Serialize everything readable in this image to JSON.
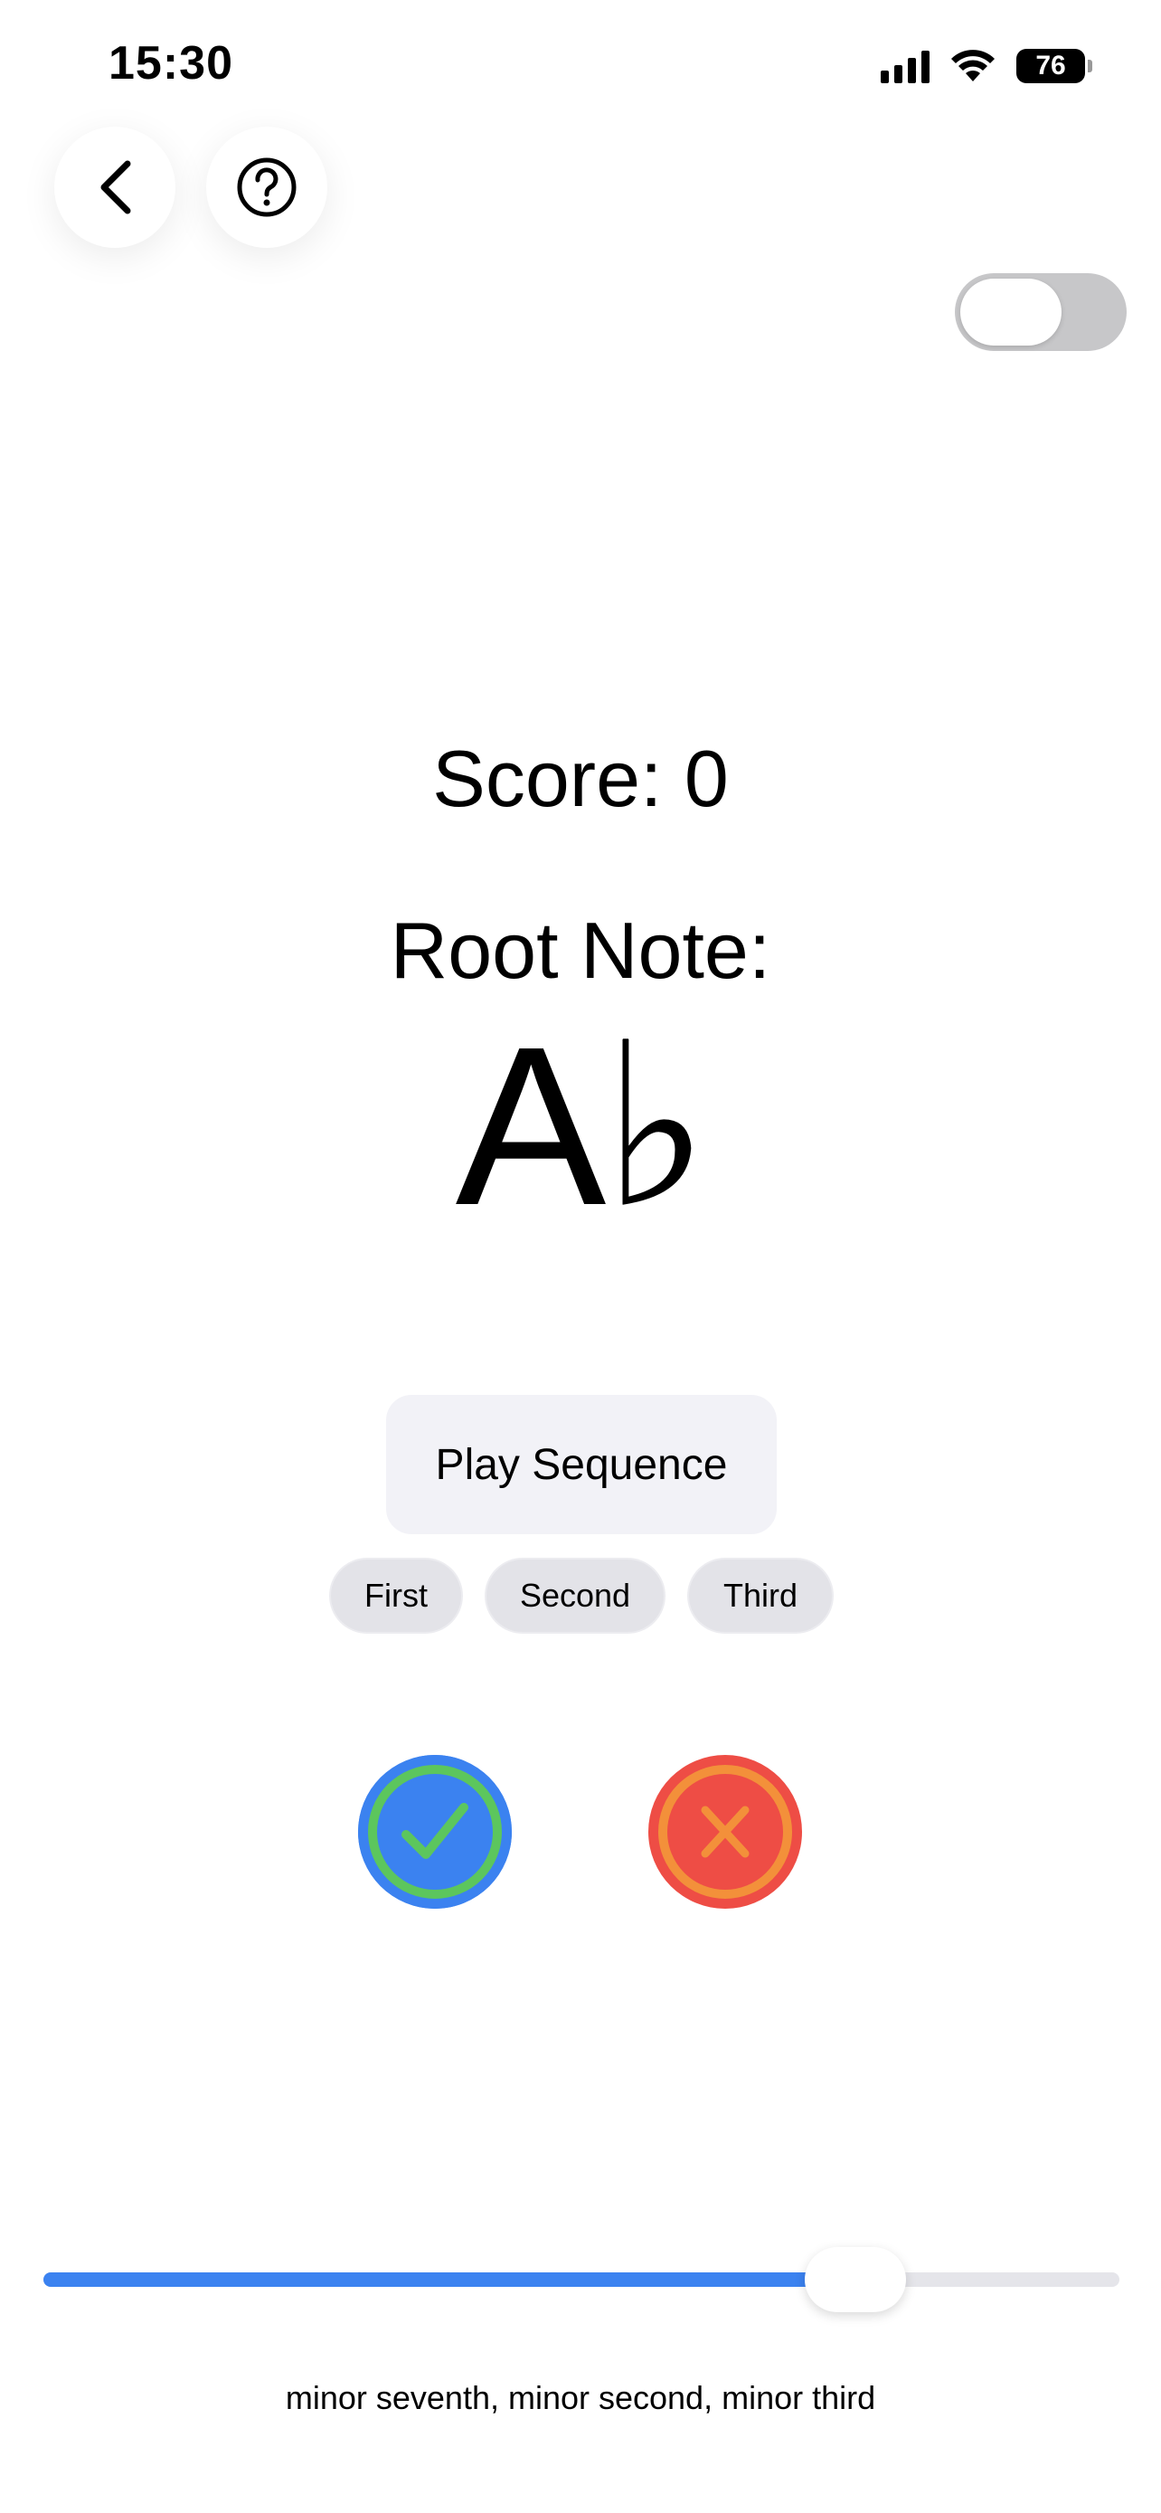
{
  "status_bar": {
    "time": "15:30",
    "battery_level": "76",
    "icons": [
      "signal-icon",
      "wifi-icon",
      "battery-icon"
    ]
  },
  "nav": {
    "back_icon": "chevron-left-icon",
    "help_icon": "question-circle-icon"
  },
  "toggle": {
    "on": false
  },
  "game": {
    "score_text": "Score: 0",
    "root_label": "Root Note:",
    "root_note": "A♭"
  },
  "controls": {
    "play_label": "Play Sequence",
    "choices": [
      "First",
      "Second",
      "Third"
    ],
    "confirm_icon": "checkmark-icon",
    "reject_icon": "x-icon"
  },
  "slider": {
    "fraction": 0.755
  },
  "caption": "minor seventh, minor second, minor third",
  "colors": {
    "accent_blue": "#3b82f0",
    "check_green": "#5cc65d",
    "reject_red": "#ee4d45",
    "reject_orange": "#f3903a",
    "button_bg": "#f2f2f7",
    "pill_bg": "#e3e3e8"
  }
}
